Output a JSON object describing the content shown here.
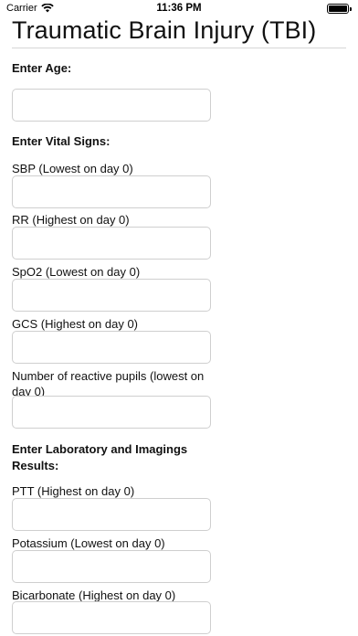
{
  "status_bar": {
    "carrier": "Carrier",
    "time": "11:36 PM"
  },
  "header": {
    "title": "Traumatic Brain Injury (TBI)"
  },
  "sections": {
    "age": {
      "heading": "Enter Age:"
    },
    "vitals": {
      "heading": "Enter Vital Signs:",
      "fields": [
        {
          "label": "SBP (Lowest on day 0)",
          "value": ""
        },
        {
          "label": "RR (Highest on day 0)",
          "value": ""
        },
        {
          "label": "SpO2 (Lowest on day 0)",
          "value": ""
        },
        {
          "label": "GCS (Highest on day 0)",
          "value": ""
        },
        {
          "label": "Number of reactive pupils (lowest on day 0)",
          "value": ""
        }
      ]
    },
    "labs": {
      "heading": "Enter Laboratory and Imagings Results:",
      "fields": [
        {
          "label": "PTT (Highest on day 0)",
          "value": ""
        },
        {
          "label": "Potassium (Lowest on day 0)",
          "value": ""
        },
        {
          "label": "Bicarbonate (Highest on day 0)",
          "value": ""
        }
      ]
    }
  },
  "age_value": "",
  "icons": {
    "wifi": "wifi-icon",
    "battery": "battery-icon"
  }
}
